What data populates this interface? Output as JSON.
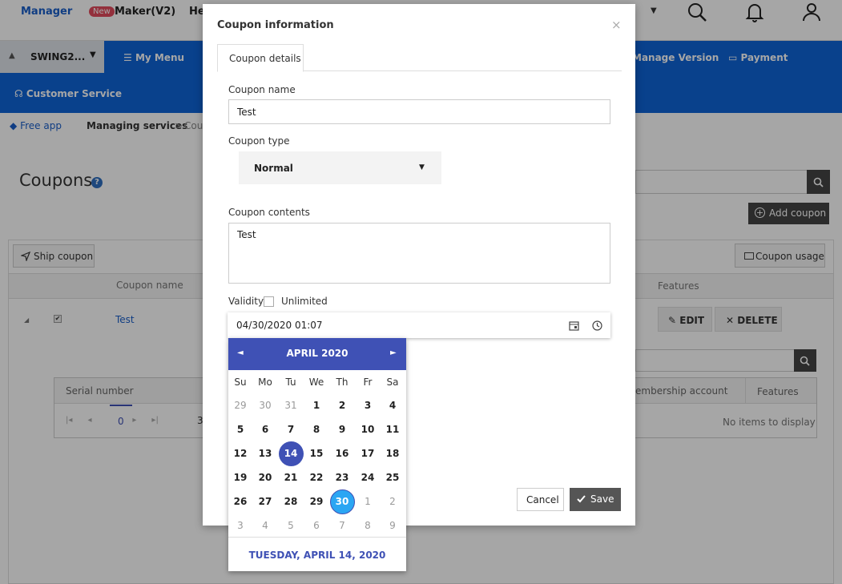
{
  "topbar": {
    "brand": "Manager",
    "new_badge": "New",
    "maker": "Maker(V2)",
    "help_partial": "He"
  },
  "navbar": {
    "project": "SWING2...",
    "my_menu": "My Menu",
    "manage_version": "Manage Version",
    "payment": "Payment",
    "customer_service": "Customer Service"
  },
  "breadcrumb": {
    "free_app": "Free app",
    "managing": "Managing services",
    "separator": ">",
    "current_partial": "Cou"
  },
  "page": {
    "title": "Coupons",
    "help": "?",
    "add_coupon": "Add coupon",
    "ship_coupon": "Ship coupon",
    "coupon_usage": "Coupon usage",
    "table": {
      "col_name": "Coupon name",
      "col_features": "Features",
      "row_name": "Test",
      "edit": "EDIT",
      "delete": "DELETE"
    },
    "subtable": {
      "col_serial": "Serial number",
      "col_member": "embership account",
      "col_features": "Features",
      "pager_current": "0",
      "pager_total_partial": "3",
      "empty": "No items to display"
    }
  },
  "modal": {
    "title": "Coupon information",
    "close": "×",
    "tab": "Coupon details",
    "name_label": "Coupon name",
    "name_value": "Test",
    "type_label": "Coupon type",
    "type_value": "Normal",
    "contents_label": "Coupon contents",
    "contents_value": "Test",
    "validity_label": "Validity",
    "unlimited_label": "Unlimited",
    "date_value": "04/30/2020 01:07",
    "cancel": "Cancel",
    "save": "Save"
  },
  "calendar": {
    "month": "APRIL 2020",
    "prev": "◄",
    "next": "►",
    "weekdays": [
      "Su",
      "Mo",
      "Tu",
      "We",
      "Th",
      "Fr",
      "Sa"
    ],
    "weeks": [
      [
        "29",
        "30",
        "31",
        "1",
        "2",
        "3",
        "4"
      ],
      [
        "5",
        "6",
        "7",
        "8",
        "9",
        "10",
        "11"
      ],
      [
        "12",
        "13",
        "14",
        "15",
        "16",
        "17",
        "18"
      ],
      [
        "19",
        "20",
        "21",
        "22",
        "23",
        "24",
        "25"
      ],
      [
        "26",
        "27",
        "28",
        "29",
        "30",
        "1",
        "2"
      ],
      [
        "3",
        "4",
        "5",
        "6",
        "7",
        "8",
        "9"
      ]
    ],
    "footer": "TUESDAY, APRIL 14, 2020",
    "selected_day": "30",
    "today_day": "14"
  },
  "colors": {
    "nav_blue": "#0e64d8",
    "calendar_indigo": "#3f51b5",
    "selected_light_blue": "#2ba6f3"
  }
}
